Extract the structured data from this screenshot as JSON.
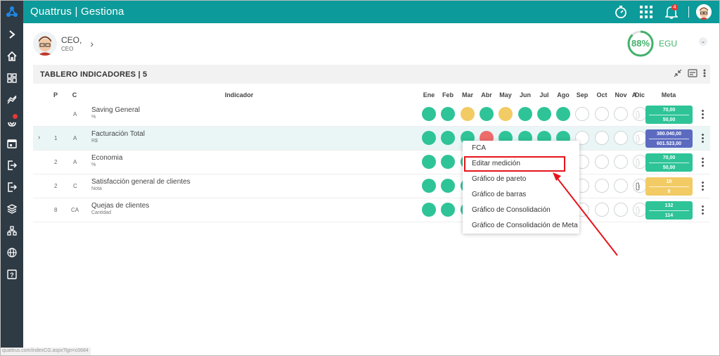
{
  "app": {
    "title": "Quattrus | Gestiona"
  },
  "topbar": {
    "icons": [
      "timer-icon",
      "apps-grid-icon",
      "bell-icon",
      "avatar"
    ],
    "bell_count": "4"
  },
  "sidebar": {
    "items": [
      {
        "icon": "chevron-right-icon"
      },
      {
        "icon": "home-icon"
      },
      {
        "icon": "dashboard-icon"
      },
      {
        "icon": "trend-icon"
      },
      {
        "icon": "alert-icon",
        "badge": true
      },
      {
        "icon": "calendar-icon"
      },
      {
        "icon": "export-icon"
      },
      {
        "icon": "import-icon"
      },
      {
        "icon": "layers-icon"
      },
      {
        "icon": "org-chart-icon"
      },
      {
        "icon": "globe-icon"
      },
      {
        "icon": "help-icon"
      }
    ]
  },
  "profile": {
    "name": "CEO,",
    "role": "CEO"
  },
  "score": {
    "value": "88%",
    "percent": 88,
    "label": "EGU",
    "color": "#43b26b"
  },
  "panel": {
    "title": "TABLERO INDICADORES | 5"
  },
  "table": {
    "headers": {
      "p": "P",
      "c": "C",
      "indicador": "Indicador",
      "months": [
        "Ene",
        "Feb",
        "Mar",
        "Abr",
        "May",
        "Jun",
        "Jul",
        "Ago",
        "Sep",
        "Oct",
        "Nov",
        "Dic"
      ],
      "a": "A",
      "meta": "Meta"
    },
    "rows": [
      {
        "p": "",
        "c": "A",
        "name": "Saving General",
        "unit": "%",
        "months": [
          "g",
          "g",
          "y",
          "g",
          "y",
          "g",
          "g",
          "g",
          "e",
          "e",
          "e",
          "e"
        ],
        "meta_top": "70,00",
        "meta_bottom": "50,00",
        "meta_color": "#2ec497",
        "expand": false,
        "attach": false
      },
      {
        "p": "1",
        "c": "A",
        "name": "Facturación Total",
        "unit": "R$",
        "months": [
          "g",
          "g",
          "g",
          "r",
          "g",
          "g",
          "g",
          "g",
          "e",
          "e",
          "e",
          "e"
        ],
        "meta_top": "380.040,00",
        "meta_bottom": "601.523,00",
        "meta_color": "#5c6bc0",
        "expand": true,
        "attach": false
      },
      {
        "p": "2",
        "c": "A",
        "name": "Economia",
        "unit": "%",
        "months": [
          "g",
          "g",
          "g",
          "g",
          "g",
          "g",
          "g",
          "g",
          "e",
          "e",
          "e",
          "e"
        ],
        "meta_top": "70,00",
        "meta_bottom": "50,00",
        "meta_color": "#2ec497",
        "expand": false,
        "attach": false
      },
      {
        "p": "2",
        "c": "C",
        "name": "Satisfacción general de clientes",
        "unit": "Nota",
        "months": [
          "g",
          "g",
          "g",
          "g",
          "g",
          "g",
          "g",
          "g",
          "e",
          "e",
          "e",
          "e"
        ],
        "meta_top": "10",
        "meta_bottom": "9",
        "meta_color": "#f2cb65",
        "expand": false,
        "attach": true
      },
      {
        "p": "8",
        "c": "CA",
        "name": "Quejas de clientes",
        "unit": "Cantidad",
        "months": [
          "g",
          "g",
          "g",
          "g",
          "g",
          "g",
          "g",
          "g",
          "e",
          "e",
          "e",
          "e"
        ],
        "meta_top": "132",
        "meta_bottom": "114",
        "meta_color": "#2ec497",
        "expand": false,
        "attach": false
      }
    ]
  },
  "context_menu": {
    "items": [
      "FCA",
      "Editar medición",
      "Gráfico de pareto",
      "Gráfico de barras",
      "Gráfico de Consolidación",
      "Gráfico de Consolidación de Meta"
    ],
    "selected_index": 1
  },
  "status_url": "quattrus.com/indexCG.aspx?lgn=c0684",
  "colors": {
    "accent": "#0c9b9a",
    "sidebar": "#2e3a44",
    "green": "#2ec497",
    "yellow": "#f2cb65",
    "red": "#ee6b6b",
    "annotation": "#e5141b"
  }
}
